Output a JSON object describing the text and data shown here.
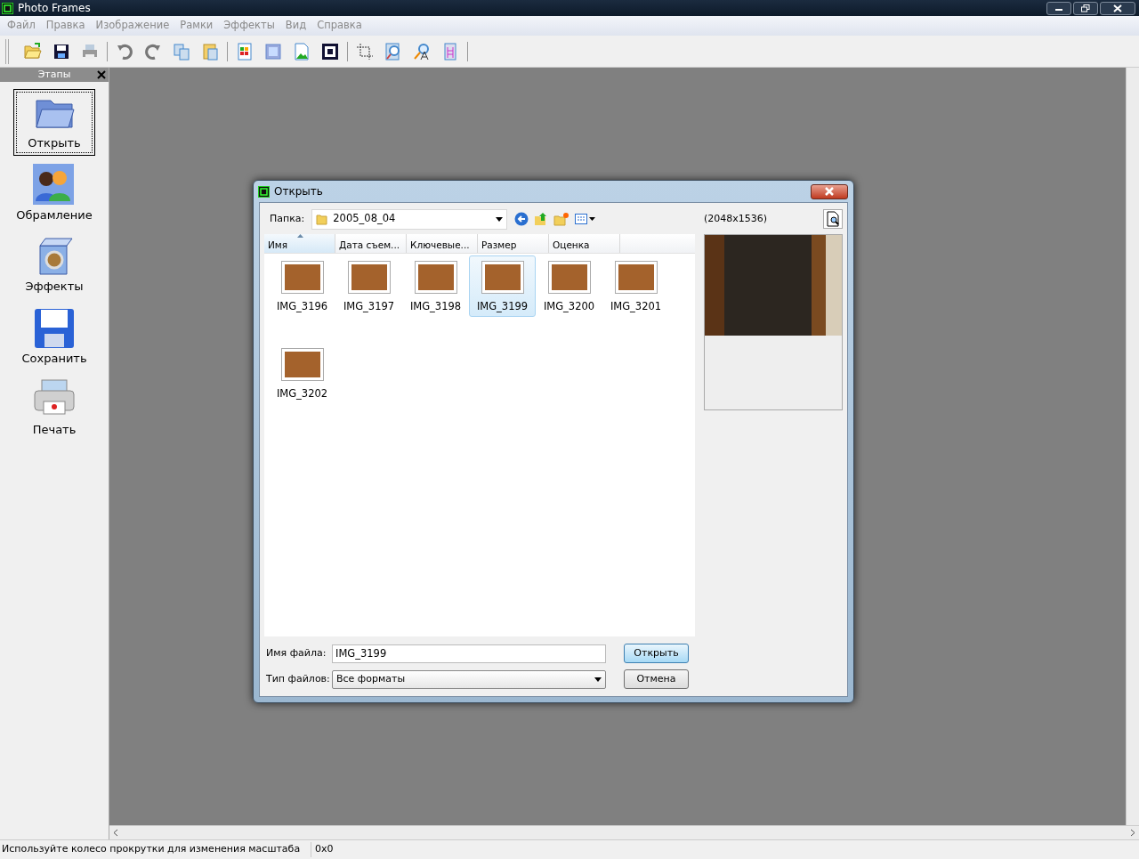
{
  "window": {
    "title": "Photo Frames"
  },
  "menu": [
    "Файл",
    "Правка",
    "Изображение",
    "Рамки",
    "Эффекты",
    "Вид",
    "Справка"
  ],
  "stages_panel": {
    "title": "Этапы",
    "items": [
      {
        "label": "Открыть",
        "kind": "open",
        "selected": true
      },
      {
        "label": "Обрамление",
        "kind": "people",
        "selected": false
      },
      {
        "label": "Эффекты",
        "kind": "effects",
        "selected": false
      },
      {
        "label": "Сохранить",
        "kind": "save",
        "selected": false
      },
      {
        "label": "Печать",
        "kind": "print",
        "selected": false
      }
    ]
  },
  "dialog": {
    "title": "Открыть",
    "folder_label": "Папка:",
    "folder": "2005_08_04",
    "columns": [
      {
        "label": "Имя",
        "sorted": true
      },
      {
        "label": "Дата съем...",
        "sorted": false
      },
      {
        "label": "Ключевые...",
        "sorted": false
      },
      {
        "label": "Размер",
        "sorted": false
      },
      {
        "label": "Оценка",
        "sorted": false
      }
    ],
    "files": [
      {
        "name": "IMG_3196",
        "selected": false
      },
      {
        "name": "IMG_3197",
        "selected": false
      },
      {
        "name": "IMG_3198",
        "selected": false
      },
      {
        "name": "IMG_3199",
        "selected": true
      },
      {
        "name": "IMG_3200",
        "selected": false
      },
      {
        "name": "IMG_3201",
        "selected": false
      },
      {
        "name": "IMG_3202",
        "selected": false
      }
    ],
    "preview": {
      "dimensions": "(2048x1536)"
    },
    "filename_label": "Имя файла:",
    "filename": "IMG_3199",
    "filetype_label": "Тип файлов:",
    "filetype": "Все форматы",
    "buttons": [
      {
        "label": "Открыть",
        "kind": "default"
      },
      {
        "label": "Отмена",
        "kind": "normal"
      }
    ]
  },
  "status_bar": {
    "message": "Используйте колесо прокрутки для изменения масштаба",
    "coords": "0x0"
  }
}
